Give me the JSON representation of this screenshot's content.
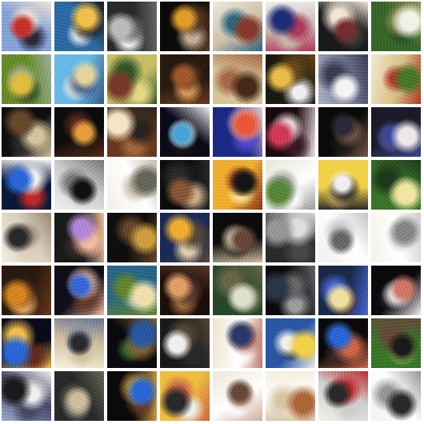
{
  "grid": {
    "rows": 8,
    "cols": 8,
    "tiles": [
      {
        "palette": [
          "#8aa6d8",
          "#c8312a",
          "#f2e6d6",
          "#2b2a3b"
        ],
        "style": "portrait"
      },
      {
        "palette": [
          "#2d6ea8",
          "#f2c14e",
          "#1b1b1b",
          "#f0f0f0"
        ],
        "style": "swirl"
      },
      {
        "palette": [
          "#2b2b2b",
          "#bdbdbd",
          "#6c6c6c",
          "#f2f2f2"
        ],
        "style": "gray"
      },
      {
        "palette": [
          "#0b0b0b",
          "#e0a02a",
          "#5a3a21",
          "#c8b39a"
        ],
        "style": "dark-figure"
      },
      {
        "palette": [
          "#efe9dd",
          "#8b3b2a",
          "#2f6a82",
          "#cfc3ad"
        ],
        "style": "light"
      },
      {
        "palette": [
          "#f1eef0",
          "#1e2f7a",
          "#b13b5d",
          "#c9b9b1"
        ],
        "style": "light-blue"
      },
      {
        "palette": [
          "#1a1a1a",
          "#7b2f2f",
          "#f2e6d6",
          "#3d3d3d"
        ],
        "style": "dark"
      },
      {
        "palette": [
          "#3a6a2a",
          "#f2f1ea",
          "#9a9a5a",
          "#2b4c2a"
        ],
        "style": "green"
      },
      {
        "palette": [
          "#6a8f2a",
          "#e0c040",
          "#a0b0a0",
          "#2a4a2a"
        ],
        "style": "green-pattern"
      },
      {
        "palette": [
          "#6bbbe6",
          "#e5d5a2",
          "#3a5a8a",
          "#f0eadf"
        ],
        "style": "sky"
      },
      {
        "palette": [
          "#c9c06a",
          "#7a3c2a",
          "#2f5a2a",
          "#e6d98a"
        ],
        "style": "pattern"
      },
      {
        "palette": [
          "#2a1a10",
          "#a45b2e",
          "#6b3c1e",
          "#d59a5c"
        ],
        "style": "brown"
      },
      {
        "palette": [
          "#d6c79a",
          "#4a2a1a",
          "#a86a4a",
          "#f0e2c0"
        ],
        "style": "brown-figure"
      },
      {
        "palette": [
          "#1a1a10",
          "#e8c04a",
          "#6a4a1a",
          "#f0f0f0"
        ],
        "style": "yellow-dark"
      },
      {
        "palette": [
          "#b0b2c0",
          "#f5f5f5",
          "#3d3d55",
          "#7a7f9a"
        ],
        "style": "gray-light"
      },
      {
        "palette": [
          "#f3ead2",
          "#4a7a2a",
          "#b43b2a",
          "#d8c38a"
        ],
        "style": "light-green"
      },
      {
        "palette": [
          "#0f0f0f",
          "#6a4a2a",
          "#d6c6a0",
          "#2a2a2a"
        ],
        "style": "dark-figure"
      },
      {
        "palette": [
          "#0c0c0c",
          "#e6a040",
          "#5a2a1a",
          "#2b1d14"
        ],
        "style": "dark"
      },
      {
        "palette": [
          "#6d3b20",
          "#f5e6c8",
          "#2b2420",
          "#a46a3a"
        ],
        "style": "brown"
      },
      {
        "palette": [
          "#0a0a1a",
          "#4aa6d8",
          "#f0f0f0",
          "#1a1a1a"
        ],
        "style": "dark-blue"
      },
      {
        "palette": [
          "#1d2b8a",
          "#e95a3a",
          "#f0d0d0",
          "#5a4ad0"
        ],
        "style": "blue"
      },
      {
        "palette": [
          "#1a0a10",
          "#d03b5a",
          "#f0e0e0",
          "#3a1a2a"
        ],
        "style": "dark-red"
      },
      {
        "palette": [
          "#0a0a0a",
          "#2a2a3a",
          "#7a5a4a",
          "#1a1a1a"
        ],
        "style": "dark"
      },
      {
        "palette": [
          "#1b1b2a",
          "#f0e8e8",
          "#3a4a9a",
          "#8a6a9a"
        ],
        "style": "dark-blue"
      },
      {
        "palette": [
          "#0a1a3a",
          "#2a6ad8",
          "#f0f0f0",
          "#c02a2a"
        ],
        "style": "blue"
      },
      {
        "palette": [
          "#f2f2f2",
          "#111111",
          "#7a7a7a",
          "#d0d0d0"
        ],
        "style": "bw"
      },
      {
        "palette": [
          "#f4f1e6",
          "#6a6a5a",
          "#c8c0b0",
          "#ffffff"
        ],
        "style": "light"
      },
      {
        "palette": [
          "#0c0c0c",
          "#8a5a3a",
          "#2a2a2a",
          "#d0b090"
        ],
        "style": "dark"
      },
      {
        "palette": [
          "#f0b030",
          "#151515",
          "#8a3a1a",
          "#fff0a0"
        ],
        "style": "orange"
      },
      {
        "palette": [
          "#e8e8d8",
          "#5a8a3a",
          "#a0a0a0",
          "#ffffff"
        ],
        "style": "light-green"
      },
      {
        "palette": [
          "#f3d34a",
          "#f0f0f0",
          "#2a2a2a",
          "#c0a060"
        ],
        "style": "yellow"
      },
      {
        "palette": [
          "#3a7a2a",
          "#f2e6a6",
          "#1f3a1a",
          "#9ab05a"
        ],
        "style": "green"
      },
      {
        "palette": [
          "#f2eee0",
          "#2a2a2a",
          "#9a8a7a",
          "#dcd2c0"
        ],
        "style": "light-figure"
      },
      {
        "palette": [
          "#1a1a1a",
          "#b58ad8",
          "#f0c0a0",
          "#3a2a2a"
        ],
        "style": "dark"
      },
      {
        "palette": [
          "#0e0e0e",
          "#d0a040",
          "#6a4a2a",
          "#3a2a1a"
        ],
        "style": "dark"
      },
      {
        "palette": [
          "#1a2a5a",
          "#f0b030",
          "#5a4a3a",
          "#e0d0b0"
        ],
        "style": "blue"
      },
      {
        "palette": [
          "#0c0c0c",
          "#6a4a3a",
          "#d0c0a0",
          "#2a2a2a"
        ],
        "style": "dark"
      },
      {
        "palette": [
          "#2b2b2b",
          "#9a9a9a",
          "#e0e0e0",
          "#4a4a4a"
        ],
        "style": "gray"
      },
      {
        "palette": [
          "#f0f0f0",
          "#6a6a6a",
          "#c8c8c8",
          "#ffffff"
        ],
        "style": "light"
      },
      {
        "palette": [
          "#f6f3ea",
          "#8a8a8a",
          "#cfcfcf",
          "#ffffff"
        ],
        "style": "light"
      },
      {
        "palette": [
          "#2a1a10",
          "#d88a20",
          "#6a3a1a",
          "#f0c070"
        ],
        "style": "brown"
      },
      {
        "palette": [
          "#0f0f1a",
          "#3a6ad8",
          "#f0c0a0",
          "#6a3a2a"
        ],
        "style": "dark-blue"
      },
      {
        "palette": [
          "#2a6a8a",
          "#f0e0b0",
          "#6a8a2a",
          "#a0c0d0"
        ],
        "style": "mixed"
      },
      {
        "palette": [
          "#1c0f0a",
          "#e2a26a",
          "#5a3a2a",
          "#a06a3a"
        ],
        "style": "dark"
      },
      {
        "palette": [
          "#2a4a2a",
          "#e0e0d0",
          "#6a6a4a",
          "#a0a080"
        ],
        "style": "green"
      },
      {
        "palette": [
          "#0a0a10",
          "#2a3a4a",
          "#6a6a6a",
          "#a0a0a0"
        ],
        "style": "dark"
      },
      {
        "palette": [
          "#1a2a4a",
          "#f0e0a0",
          "#4a6ad8",
          "#6a3a2a"
        ],
        "style": "blue"
      },
      {
        "palette": [
          "#0b0b0b",
          "#d07a6a",
          "#f0f0f0",
          "#2a2a3a"
        ],
        "style": "dark"
      },
      {
        "palette": [
          "#0a0a1a",
          "#2a6ad8",
          "#f0c050",
          "#6a2a1a"
        ],
        "style": "dark-blue"
      },
      {
        "palette": [
          "#f6f1df",
          "#2a2a2a",
          "#6a7a9a",
          "#d0c0a0"
        ],
        "style": "light"
      },
      {
        "palette": [
          "#0a0a10",
          "#2a5aa8",
          "#8a6a2a",
          "#3a6a2a"
        ],
        "style": "dark"
      },
      {
        "palette": [
          "#1a1a1a",
          "#f0f0f0",
          "#5a4a3a",
          "#2a2a2a"
        ],
        "style": "dark"
      },
      {
        "palette": [
          "#f0e6d0",
          "#2a3a6a",
          "#c08070",
          "#ffffff"
        ],
        "style": "light"
      },
      {
        "palette": [
          "#2a5aa8",
          "#f3d34a",
          "#f0f0f0",
          "#1a1a1a"
        ],
        "style": "blue-yellow"
      },
      {
        "palette": [
          "#0a0a0a",
          "#2a6ad8",
          "#d06a4a",
          "#3a2a2a"
        ],
        "style": "dark"
      },
      {
        "palette": [
          "#3a7a2a",
          "#1a1a1a",
          "#6a4a3a",
          "#a0c050"
        ],
        "style": "green"
      },
      {
        "palette": [
          "#9ab0d0",
          "#1a1a1a",
          "#f0f0f0",
          "#4a4a6a"
        ],
        "style": "light-blue"
      },
      {
        "palette": [
          "#2a2a2a",
          "#d0c0a0",
          "#6a6a5a",
          "#a0a090"
        ],
        "style": "gray"
      },
      {
        "palette": [
          "#0a0a0a",
          "#2a6ad8",
          "#d0a040",
          "#6a3a2a"
        ],
        "style": "dark"
      },
      {
        "palette": [
          "#f0c040",
          "#2a2a2a",
          "#d06a4a",
          "#f0f0f0"
        ],
        "style": "orange"
      },
      {
        "palette": [
          "#f0e8d8",
          "#6a4a3a",
          "#d0b0a0",
          "#ffffff"
        ],
        "style": "light"
      },
      {
        "palette": [
          "#f5f0e2",
          "#b06a3a",
          "#d8c8a8",
          "#ffffff"
        ],
        "style": "light"
      },
      {
        "palette": [
          "#f5f2ea",
          "#2a2a2a",
          "#c02a2a",
          "#d0d0d0"
        ],
        "style": "light"
      },
      {
        "palette": [
          "#f3f3f3",
          "#2a2a2a",
          "#9a9a9a",
          "#ffffff"
        ],
        "style": "light"
      }
    ]
  }
}
